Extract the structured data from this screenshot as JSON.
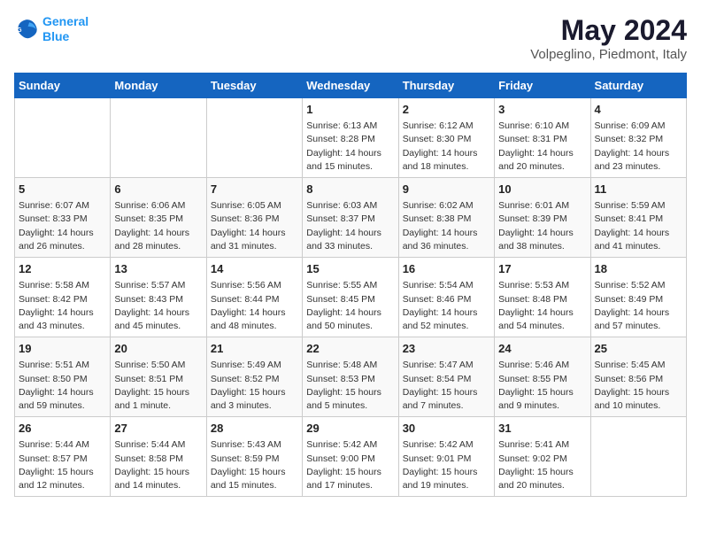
{
  "header": {
    "logo_line1": "General",
    "logo_line2": "Blue",
    "main_title": "May 2024",
    "subtitle": "Volpeglino, Piedmont, Italy"
  },
  "calendar": {
    "days_of_week": [
      "Sunday",
      "Monday",
      "Tuesday",
      "Wednesday",
      "Thursday",
      "Friday",
      "Saturday"
    ],
    "weeks": [
      [
        {
          "day": "",
          "text": ""
        },
        {
          "day": "",
          "text": ""
        },
        {
          "day": "",
          "text": ""
        },
        {
          "day": "1",
          "text": "Sunrise: 6:13 AM\nSunset: 8:28 PM\nDaylight: 14 hours\nand 15 minutes."
        },
        {
          "day": "2",
          "text": "Sunrise: 6:12 AM\nSunset: 8:30 PM\nDaylight: 14 hours\nand 18 minutes."
        },
        {
          "day": "3",
          "text": "Sunrise: 6:10 AM\nSunset: 8:31 PM\nDaylight: 14 hours\nand 20 minutes."
        },
        {
          "day": "4",
          "text": "Sunrise: 6:09 AM\nSunset: 8:32 PM\nDaylight: 14 hours\nand 23 minutes."
        }
      ],
      [
        {
          "day": "5",
          "text": "Sunrise: 6:07 AM\nSunset: 8:33 PM\nDaylight: 14 hours\nand 26 minutes."
        },
        {
          "day": "6",
          "text": "Sunrise: 6:06 AM\nSunset: 8:35 PM\nDaylight: 14 hours\nand 28 minutes."
        },
        {
          "day": "7",
          "text": "Sunrise: 6:05 AM\nSunset: 8:36 PM\nDaylight: 14 hours\nand 31 minutes."
        },
        {
          "day": "8",
          "text": "Sunrise: 6:03 AM\nSunset: 8:37 PM\nDaylight: 14 hours\nand 33 minutes."
        },
        {
          "day": "9",
          "text": "Sunrise: 6:02 AM\nSunset: 8:38 PM\nDaylight: 14 hours\nand 36 minutes."
        },
        {
          "day": "10",
          "text": "Sunrise: 6:01 AM\nSunset: 8:39 PM\nDaylight: 14 hours\nand 38 minutes."
        },
        {
          "day": "11",
          "text": "Sunrise: 5:59 AM\nSunset: 8:41 PM\nDaylight: 14 hours\nand 41 minutes."
        }
      ],
      [
        {
          "day": "12",
          "text": "Sunrise: 5:58 AM\nSunset: 8:42 PM\nDaylight: 14 hours\nand 43 minutes."
        },
        {
          "day": "13",
          "text": "Sunrise: 5:57 AM\nSunset: 8:43 PM\nDaylight: 14 hours\nand 45 minutes."
        },
        {
          "day": "14",
          "text": "Sunrise: 5:56 AM\nSunset: 8:44 PM\nDaylight: 14 hours\nand 48 minutes."
        },
        {
          "day": "15",
          "text": "Sunrise: 5:55 AM\nSunset: 8:45 PM\nDaylight: 14 hours\nand 50 minutes."
        },
        {
          "day": "16",
          "text": "Sunrise: 5:54 AM\nSunset: 8:46 PM\nDaylight: 14 hours\nand 52 minutes."
        },
        {
          "day": "17",
          "text": "Sunrise: 5:53 AM\nSunset: 8:48 PM\nDaylight: 14 hours\nand 54 minutes."
        },
        {
          "day": "18",
          "text": "Sunrise: 5:52 AM\nSunset: 8:49 PM\nDaylight: 14 hours\nand 57 minutes."
        }
      ],
      [
        {
          "day": "19",
          "text": "Sunrise: 5:51 AM\nSunset: 8:50 PM\nDaylight: 14 hours\nand 59 minutes."
        },
        {
          "day": "20",
          "text": "Sunrise: 5:50 AM\nSunset: 8:51 PM\nDaylight: 15 hours\nand 1 minute."
        },
        {
          "day": "21",
          "text": "Sunrise: 5:49 AM\nSunset: 8:52 PM\nDaylight: 15 hours\nand 3 minutes."
        },
        {
          "day": "22",
          "text": "Sunrise: 5:48 AM\nSunset: 8:53 PM\nDaylight: 15 hours\nand 5 minutes."
        },
        {
          "day": "23",
          "text": "Sunrise: 5:47 AM\nSunset: 8:54 PM\nDaylight: 15 hours\nand 7 minutes."
        },
        {
          "day": "24",
          "text": "Sunrise: 5:46 AM\nSunset: 8:55 PM\nDaylight: 15 hours\nand 9 minutes."
        },
        {
          "day": "25",
          "text": "Sunrise: 5:45 AM\nSunset: 8:56 PM\nDaylight: 15 hours\nand 10 minutes."
        }
      ],
      [
        {
          "day": "26",
          "text": "Sunrise: 5:44 AM\nSunset: 8:57 PM\nDaylight: 15 hours\nand 12 minutes."
        },
        {
          "day": "27",
          "text": "Sunrise: 5:44 AM\nSunset: 8:58 PM\nDaylight: 15 hours\nand 14 minutes."
        },
        {
          "day": "28",
          "text": "Sunrise: 5:43 AM\nSunset: 8:59 PM\nDaylight: 15 hours\nand 15 minutes."
        },
        {
          "day": "29",
          "text": "Sunrise: 5:42 AM\nSunset: 9:00 PM\nDaylight: 15 hours\nand 17 minutes."
        },
        {
          "day": "30",
          "text": "Sunrise: 5:42 AM\nSunset: 9:01 PM\nDaylight: 15 hours\nand 19 minutes."
        },
        {
          "day": "31",
          "text": "Sunrise: 5:41 AM\nSunset: 9:02 PM\nDaylight: 15 hours\nand 20 minutes."
        },
        {
          "day": "",
          "text": ""
        }
      ]
    ]
  }
}
